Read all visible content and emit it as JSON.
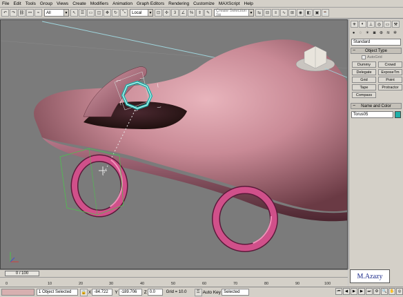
{
  "menu": {
    "items": [
      "File",
      "Edit",
      "Tools",
      "Group",
      "Views",
      "Create",
      "Modifiers",
      "Animation",
      "Graph Editors",
      "Rendering",
      "Customize",
      "MAXScript",
      "Help"
    ]
  },
  "toolbar": {
    "filter_value": "All",
    "coord_value": "Local",
    "selection_set_placeholder": "Create Selection Se"
  },
  "panel": {
    "category_value": "Standard",
    "object_type_title": "Object Type",
    "autogrid_label": "AutoGrid",
    "buttons": [
      "Dummy",
      "Crowd",
      "Delegate",
      "ExposeTm",
      "Grid",
      "Point",
      "Tape",
      "Protractor",
      "Compass"
    ],
    "name_color_title": "Name and Color",
    "object_name": "Torus05",
    "object_color": "#1fb0a8"
  },
  "timeline": {
    "frame_display": "0 / 100",
    "ticks": [
      "0",
      "10",
      "20",
      "30",
      "40",
      "50",
      "60",
      "70",
      "80",
      "90",
      "100"
    ]
  },
  "status": {
    "selection_text": "1 Object Selected",
    "x_label": "X",
    "x_value": "-84.722",
    "y_label": "Y",
    "y_value": "-189.706",
    "z_label": "Z",
    "z_value": "0.0",
    "grid_text": "Grid = 10.0",
    "autokey_label": "Auto Key",
    "key_mode_value": "Selected"
  },
  "watermark": {
    "text": "M.Azazy"
  },
  "scene": {
    "car_color": "#c98a96",
    "wheel_color": "#d0508a",
    "selected_color": "#1fb0a8"
  }
}
